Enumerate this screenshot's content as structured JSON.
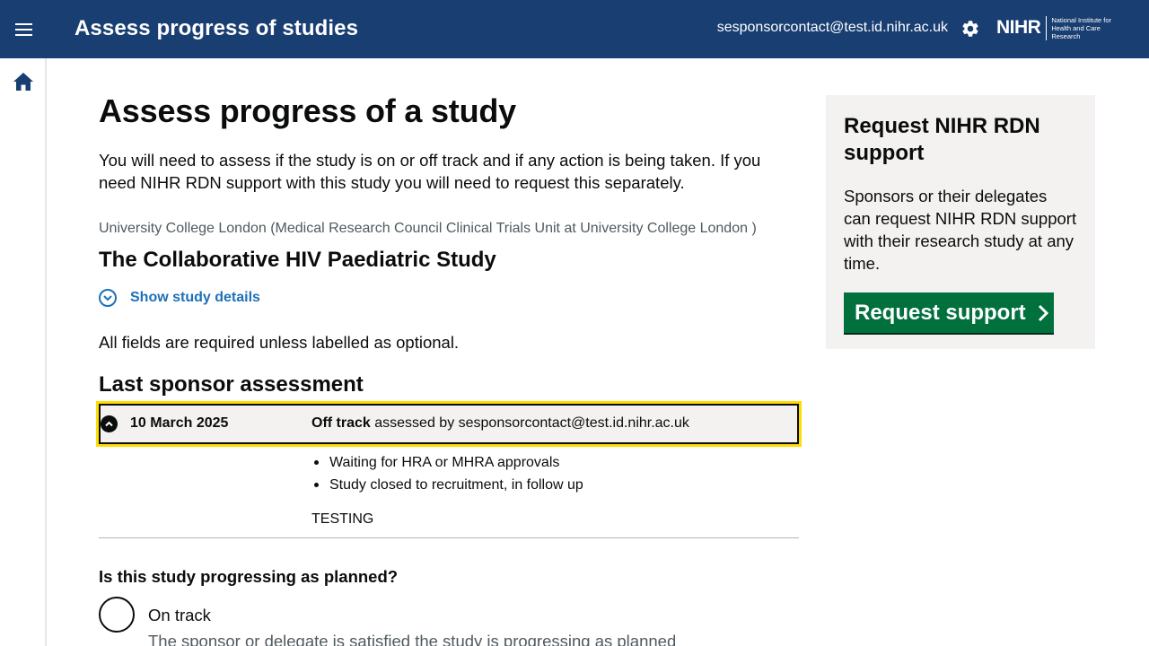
{
  "header": {
    "title": "Assess progress of studies",
    "user_email": "sesponsorcontact@test.id.nihr.ac.uk",
    "logo_main": "NIHR",
    "logo_sub": "National Institute for Health and Care Research"
  },
  "icons": {
    "menu": "hamburger-menu-icon",
    "settings": "gear-icon",
    "home": "home-icon",
    "details": "chevron-down-circle-icon",
    "collapse": "chevron-up-circle-icon",
    "button_arrow": "chevron-right-icon"
  },
  "colors": {
    "header_bg": "#193e72",
    "link": "#1d70b8",
    "button": "#00703c",
    "focus": "#ffdd00"
  },
  "main": {
    "heading": "Assess progress of a study",
    "intro": "You will need to assess if the study is on or off track and if any action is being taken. If you need NIHR RDN support with this study you will need to request this separately.",
    "organisation": "University College London (Medical Research Council Clinical Trials Unit at University College London )",
    "study_title": "The Collaborative HIV Paediatric Study",
    "show_details": "Show study details",
    "fields_note": "All fields are required unless labelled as optional.",
    "last_assessment_heading": "Last sponsor assessment",
    "last_assessment": {
      "date": "10 March 2025",
      "status": "Off track",
      "assessed_by_text": "assessed by sesponsorcontact@test.id.nihr.ac.uk",
      "reasons": [
        "Waiting for HRA or MHRA approvals",
        "Study closed to recruitment, in follow up"
      ],
      "comment": "TESTING"
    },
    "question": "Is this study progressing as planned?",
    "option_on_track": {
      "label": "On track",
      "hint": "The sponsor or delegate is satisfied the study is progressing as planned"
    }
  },
  "panel": {
    "title": "Request NIHR RDN support",
    "text": "Sponsors or their delegates can request NIHR RDN support with their research study at any time.",
    "button": "Request support"
  }
}
